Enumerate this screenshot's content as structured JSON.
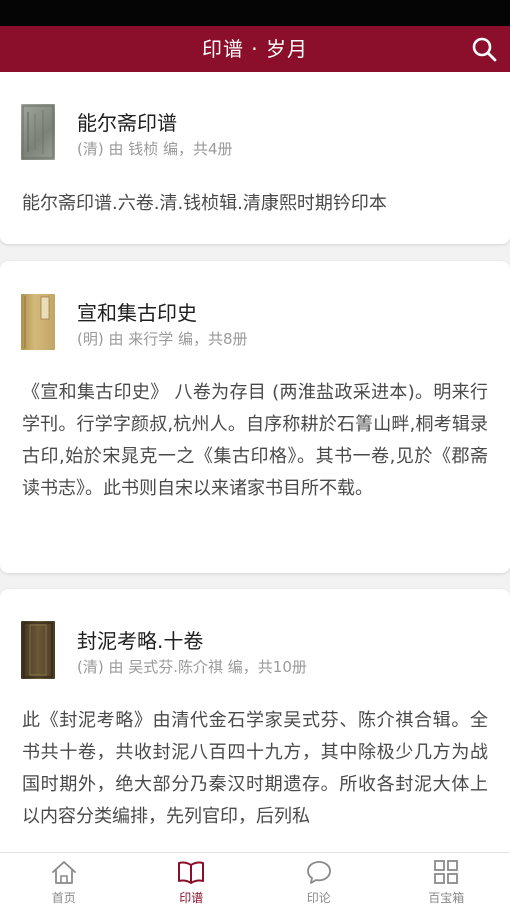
{
  "header": {
    "title": "印谱 · 岁月",
    "search_icon": "search-icon"
  },
  "books": [
    {
      "title": "能尔斋印谱",
      "meta": "(清) 由 钱桢 编，共4册",
      "description": "能尔斋印谱.六卷.清.钱桢辑.清康熙时期钤印本",
      "cover_color": "#8c9088"
    },
    {
      "title": "宣和集古印史",
      "meta": "(明) 由 来行学 编，共8册",
      "description": "《宣和集古印史》 八卷为存目 (两淮盐政采进本)。明来行学刊。行学字颜叔,杭州人。自序称耕於石箐山畔,桐考辑录古印,始於宋晁克一之《集古印格》。其书一卷,见於《郡斋读书志》。此书则自宋以来诸家书目所不载。",
      "cover_color": "#c4a86a"
    },
    {
      "title": "封泥考略.十卷",
      "meta": "(清) 由 吴式芬.陈介祺 编，共10册",
      "description": "此《封泥考略》由清代金石学家吴式芬、陈介祺合辑。全书共十卷，共收封泥八百四十九方，其中除极少几方为战国时期外，绝大部分乃秦汉时期遗存。所收各封泥大体上以内容分类编排，先列官印，后列私",
      "cover_color": "#5a4a2e"
    }
  ],
  "tabs": [
    {
      "label": "首页",
      "icon": "home-icon",
      "active": false
    },
    {
      "label": "印谱",
      "icon": "book-icon",
      "active": true
    },
    {
      "label": "印论",
      "icon": "chat-bubble-icon",
      "active": false
    },
    {
      "label": "百宝箱",
      "icon": "grid-icon",
      "active": false
    }
  ],
  "colors": {
    "brand": "#8b0f2a",
    "status_bar": "#050505",
    "background": "#f2f2f2",
    "tab_inactive": "#8a8a8a"
  }
}
